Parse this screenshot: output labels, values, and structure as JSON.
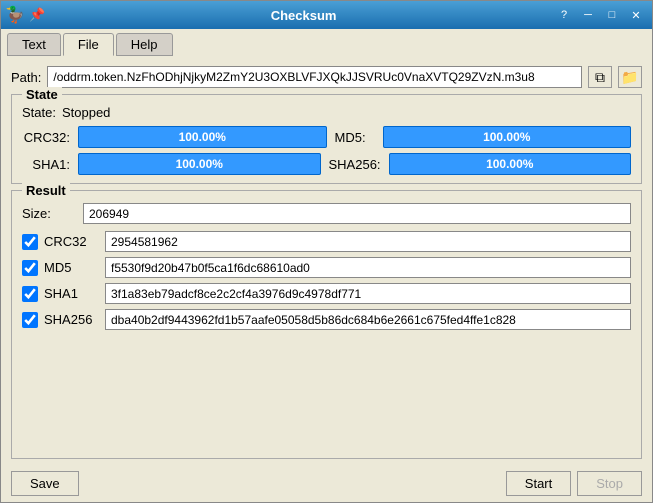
{
  "window": {
    "title": "Checksum",
    "icon": "🦆"
  },
  "titlebar": {
    "help_btn": "?",
    "minimize_btn": "─",
    "maximize_btn": "□",
    "close_btn": "✕",
    "pin_icon": "📌"
  },
  "tabs": [
    {
      "id": "text",
      "label": "Text",
      "active": false
    },
    {
      "id": "file",
      "label": "File",
      "active": true
    },
    {
      "id": "help",
      "label": "Help",
      "active": false
    }
  ],
  "path": {
    "label": "Path:",
    "value": "/oddrm.token.NzFhODhjNjkyM2ZmY2U3OXBLVFJXQkJJSVRUc0VnaXVTQ29ZVzN.m3u8",
    "copy_tooltip": "Copy",
    "browse_tooltip": "Browse"
  },
  "state": {
    "group_title": "State",
    "state_label": "State:",
    "state_value": "Stopped",
    "crc32_label": "CRC32:",
    "crc32_progress": "100.00%",
    "md5_label": "MD5:",
    "md5_progress": "100.00%",
    "sha1_label": "SHA1:",
    "sha1_progress": "100.00%",
    "sha256_label": "SHA256:",
    "sha256_progress": "100.00%"
  },
  "result": {
    "group_title": "Result",
    "size_label": "Size:",
    "size_value": "206949",
    "fields": [
      {
        "id": "crc32",
        "label": "CRC32",
        "checked": true,
        "value": "2954581962"
      },
      {
        "id": "md5",
        "label": "MD5",
        "checked": true,
        "value": "f5530f9d20b47b0f5ca1f6dc68610ad0"
      },
      {
        "id": "sha1",
        "label": "SHA1",
        "checked": true,
        "value": "3f1a83eb79adcf8ce2c2cf4a3976d9c4978df771"
      },
      {
        "id": "sha256",
        "label": "SHA256",
        "checked": true,
        "value": "dba40b2df9443962fd1b57aafe05058d5b86dc684b6e2661c675fed4ffe1c828"
      }
    ]
  },
  "footer": {
    "save_label": "Save",
    "start_label": "Start",
    "stop_label": "Stop"
  }
}
